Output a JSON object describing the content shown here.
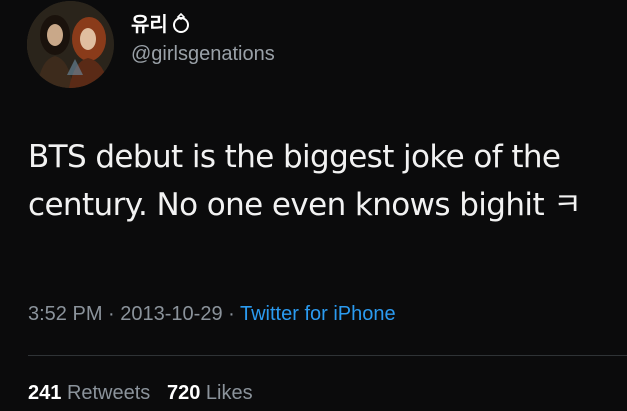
{
  "user": {
    "display_name": "유리",
    "handle": "@girlsgenations"
  },
  "tweet": {
    "text_line1": "BTS debut is the biggest joke of the",
    "text_line2": "century. No one even knows bighit ㅋ"
  },
  "meta": {
    "time": "3:52 PM",
    "separator1": " · ",
    "date": "2013-10-29",
    "separator2": " · ",
    "source": "Twitter for iPhone"
  },
  "stats": {
    "retweets_count": "241",
    "retweets_label": "Retweets",
    "likes_count": "720",
    "likes_label": "Likes"
  },
  "colors": {
    "background": "#0b0b0c",
    "link_blue": "#2b9bf0",
    "muted_gray": "#8b939b"
  }
}
